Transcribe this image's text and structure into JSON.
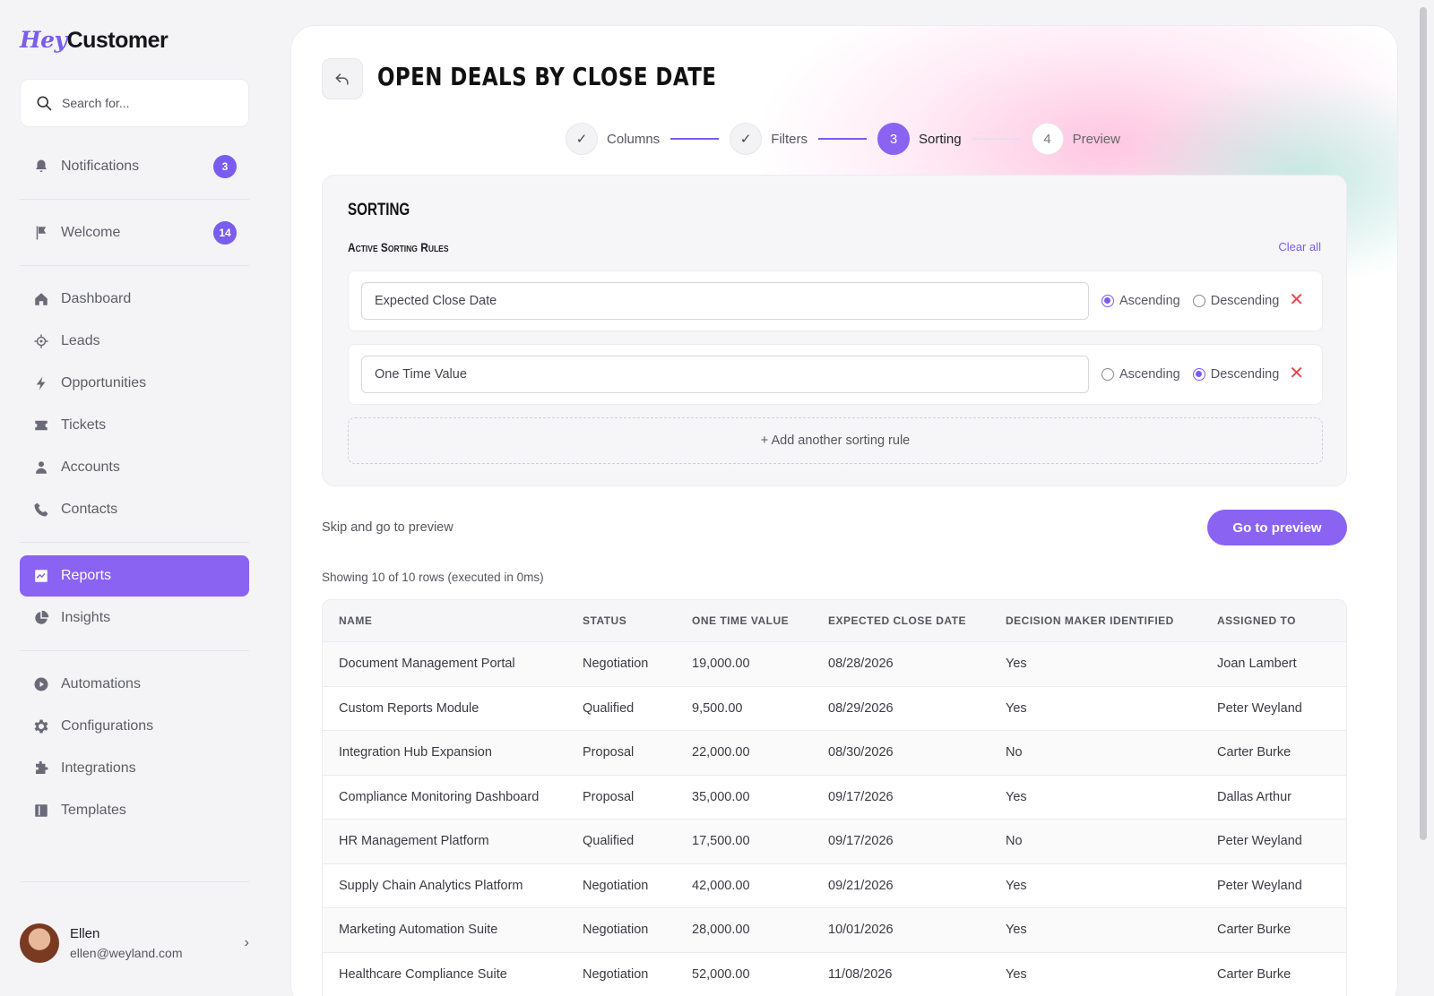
{
  "brand": {
    "hey": "Hey",
    "rest": "Customer"
  },
  "search": {
    "placeholder": "Search for..."
  },
  "sidebar": {
    "top_items": [
      {
        "label": "Notifications",
        "badge": "3"
      },
      {
        "label": "Welcome",
        "badge": "14"
      }
    ],
    "items": [
      {
        "label": "Dashboard"
      },
      {
        "label": "Leads"
      },
      {
        "label": "Opportunities"
      },
      {
        "label": "Tickets"
      },
      {
        "label": "Accounts"
      },
      {
        "label": "Contacts"
      },
      {
        "label": "Reports"
      },
      {
        "label": "Insights"
      },
      {
        "label": "Automations"
      },
      {
        "label": "Configurations"
      },
      {
        "label": "Integrations"
      },
      {
        "label": "Templates"
      }
    ]
  },
  "user": {
    "name": "Ellen",
    "email": "ellen@weyland.com"
  },
  "header": {
    "title": "OPEN DEALS BY CLOSE DATE"
  },
  "stepper": {
    "steps": [
      {
        "num": "✓",
        "label": "Columns"
      },
      {
        "num": "✓",
        "label": "Filters"
      },
      {
        "num": "3",
        "label": "Sorting"
      },
      {
        "num": "4",
        "label": "Preview"
      }
    ]
  },
  "sorting": {
    "title": "SORTING",
    "subtitle": "Active Sorting Rules",
    "clear_all": "Clear all",
    "ascending_label": "Ascending",
    "descending_label": "Descending",
    "rules": [
      {
        "field": "Expected Close Date",
        "direction": "ascending"
      },
      {
        "field": "One Time Value",
        "direction": "descending"
      }
    ],
    "add_rule": "+ Add another sorting rule"
  },
  "actions": {
    "skip": "Skip and go to preview",
    "go_preview": "Go to preview"
  },
  "table": {
    "showing": "Showing 10 of 10 rows (executed in 0ms)",
    "headers": [
      "NAME",
      "STATUS",
      "ONE TIME VALUE",
      "EXPECTED CLOSE DATE",
      "DECISION MAKER IDENTIFIED",
      "ASSIGNED TO"
    ],
    "rows": [
      [
        "Document Management Portal",
        "Negotiation",
        "19,000.00",
        "08/28/2026",
        "Yes",
        "Joan Lambert"
      ],
      [
        "Custom Reports Module",
        "Qualified",
        "9,500.00",
        "08/29/2026",
        "Yes",
        "Peter Weyland"
      ],
      [
        "Integration Hub Expansion",
        "Proposal",
        "22,000.00",
        "08/30/2026",
        "No",
        "Carter Burke"
      ],
      [
        "Compliance Monitoring Dashboard",
        "Proposal",
        "35,000.00",
        "09/17/2026",
        "Yes",
        "Dallas Arthur"
      ],
      [
        "HR Management Platform",
        "Qualified",
        "17,500.00",
        "09/17/2026",
        "No",
        "Peter Weyland"
      ],
      [
        "Supply Chain Analytics Platform",
        "Negotiation",
        "42,000.00",
        "09/21/2026",
        "Yes",
        "Peter Weyland"
      ],
      [
        "Marketing Automation Suite",
        "Negotiation",
        "28,000.00",
        "10/01/2026",
        "Yes",
        "Carter Burke"
      ],
      [
        "Healthcare Compliance Suite",
        "Negotiation",
        "52,000.00",
        "11/08/2026",
        "Yes",
        "Carter Burke"
      ]
    ]
  },
  "colors": {
    "accent": "#8a63f2",
    "danger": "#e0474c"
  }
}
